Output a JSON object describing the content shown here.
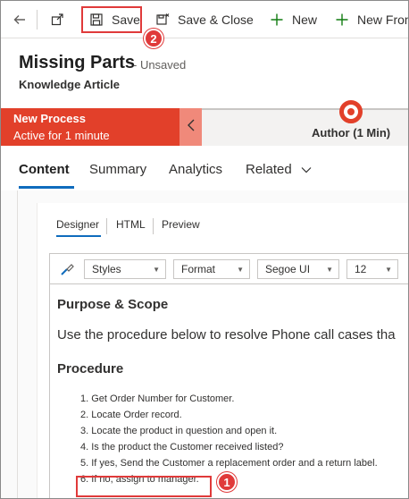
{
  "toolbar": {
    "save_label": "Save",
    "save_close_label": "Save & Close",
    "new_label": "New",
    "new_from_label": "New From"
  },
  "header": {
    "title": "Missing Parts",
    "status": "- Unsaved",
    "entity": "Knowledge Article"
  },
  "process": {
    "name": "New Process",
    "active_for": "Active for 1 minute",
    "stage": "Author",
    "stage_duration": "(1 Min)"
  },
  "tabs": [
    {
      "label": "Content"
    },
    {
      "label": "Summary"
    },
    {
      "label": "Analytics"
    },
    {
      "label": "Related"
    }
  ],
  "editor": {
    "view_tabs": [
      "Designer",
      "HTML",
      "Preview"
    ],
    "styles": "Styles",
    "format": "Format",
    "font": "Segoe UI",
    "size": "12"
  },
  "document": {
    "heading": "Purpose & Scope",
    "paragraph": "Use the procedure below to resolve Phone call cases tha",
    "procedure_heading": "Procedure",
    "steps": [
      "1. Get Order Number for Customer.",
      "2. Locate Order record.",
      "3. Locate the product in question and open it.",
      "4. Is the product the Customer received listed?",
      "5. If yes, Send the Customer a replacement order and a return label.",
      "6. If no, assign to manager."
    ]
  },
  "callouts": {
    "one": "1",
    "two": "2"
  },
  "colors": {
    "accent": "#0f6cbd",
    "process": "#e2402a",
    "callout": "#e03a3a"
  }
}
